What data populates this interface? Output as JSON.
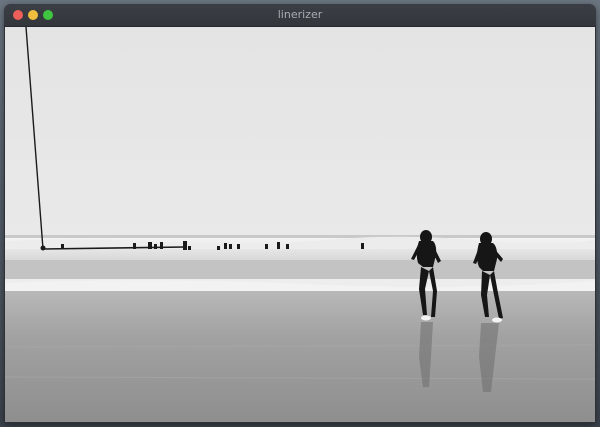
{
  "window": {
    "title": "linerizer"
  },
  "controls": {
    "close_icon": "close-icon",
    "minimize_icon": "minimize-icon",
    "maximize_icon": "maximize-icon"
  },
  "colors": {
    "close": "#ee5f5a",
    "minimize": "#f0bd3f",
    "maximize": "#3fc53f",
    "titlebar": "#35393e",
    "sky": "#e6e6e6",
    "sea": "#9d9d9d"
  }
}
